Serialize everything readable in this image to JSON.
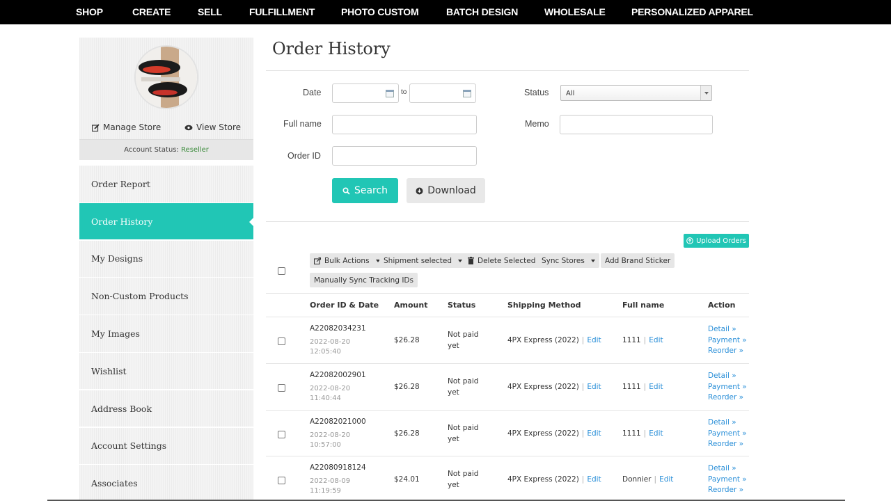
{
  "nav": [
    "SHOP",
    "CREATE",
    "SELL",
    "FULFILLMENT",
    "PHOTO CUSTOM",
    "BATCH DESIGN",
    "WHOLESALE",
    "PERSONALIZED APPAREL"
  ],
  "profile": {
    "manage_store": "Manage Store",
    "view_store": "View Store",
    "status_label": "Account Status:",
    "status_value": "Reseller"
  },
  "sidebar": [
    "Order Report",
    "Order History",
    "My Designs",
    "Non-Custom Products",
    "My Images",
    "Wishlist",
    "Address Book",
    "Account Settings",
    "Associates"
  ],
  "page_title": "Order History",
  "filters": {
    "date_label": "Date",
    "to_label": "to",
    "status_label": "Status",
    "status_value": "All",
    "fullname_label": "Full name",
    "memo_label": "Memo",
    "orderid_label": "Order ID",
    "search_label": "Search",
    "download_label": "Download"
  },
  "upload_label": "Upload Orders",
  "toolbar": {
    "bulk_actions": "Bulk Actions",
    "shipment_selected": "Shipment selected",
    "delete_selected": "Delete Selected",
    "sync_stores": "Sync Stores",
    "add_brand_sticker": "Add Brand Sticker",
    "manual_sync": "Manually Sync Tracking IDs"
  },
  "table": {
    "headers": [
      "Order ID & Date",
      "Amount",
      "Status",
      "Shipping Method",
      "Full name",
      "Action"
    ],
    "edit_label": "Edit",
    "actions": [
      "Detail »",
      "Payment »",
      "Reorder »"
    ],
    "rows": [
      {
        "order_id": "A22082034231",
        "date": "2022-08-20",
        "time": "12:05:40",
        "amount": "$26.28",
        "status1": "Not paid",
        "status2": "yet",
        "shipping": "4PX Express (2022)",
        "full_name": "1111"
      },
      {
        "order_id": "A22082002901",
        "date": "2022-08-20",
        "time": "11:40:44",
        "amount": "$26.28",
        "status1": "Not paid",
        "status2": "yet",
        "shipping": "4PX Express (2022)",
        "full_name": "1111"
      },
      {
        "order_id": "A22082021000",
        "date": "2022-08-20",
        "time": "10:57:00",
        "amount": "$26.28",
        "status1": "Not paid",
        "status2": "yet",
        "shipping": "4PX Express (2022)",
        "full_name": "1111"
      },
      {
        "order_id": "A22080918124",
        "date": "2022-08-09",
        "time": "11:19:59",
        "amount": "$24.01",
        "status1": "Not paid",
        "status2": "yet",
        "shipping": "4PX Express (2022)",
        "full_name": "Donnier"
      }
    ]
  },
  "colors": {
    "accent": "#21c6b5",
    "link": "#2a8fd8",
    "nav_bg": "#000000"
  }
}
